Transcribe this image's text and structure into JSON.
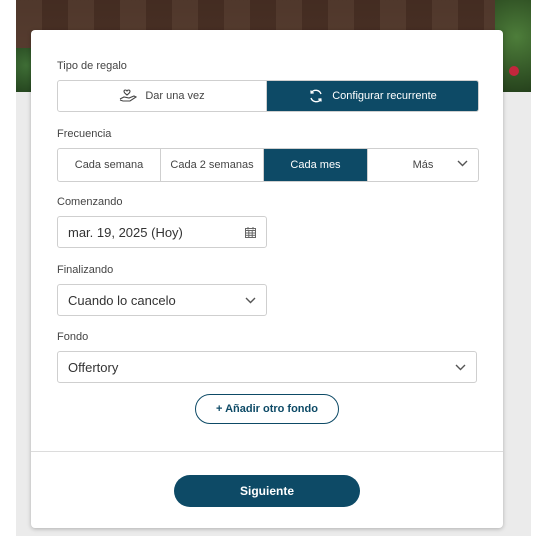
{
  "gift_type": {
    "label": "Tipo de regalo",
    "options": [
      {
        "label": "Dar una vez",
        "icon": "hand-heart-icon",
        "active": false
      },
      {
        "label": "Configurar recurrente",
        "icon": "refresh-icon",
        "active": true
      }
    ]
  },
  "frequency": {
    "label": "Frecuencia",
    "options": [
      {
        "label": "Cada semana",
        "active": false
      },
      {
        "label": "Cada 2 semanas",
        "active": false
      },
      {
        "label": "Cada mes",
        "active": true
      },
      {
        "label": "Más",
        "active": false
      }
    ]
  },
  "start": {
    "label": "Comenzando",
    "value": "mar. 19, 2025 (Hoy)",
    "icon": "calendar-icon"
  },
  "end": {
    "label": "Finalizando",
    "value": "Cuando lo cancelo",
    "icon": "chevron-down-icon"
  },
  "fund": {
    "label": "Fondo",
    "value": "Offertory",
    "icon": "chevron-down-icon"
  },
  "add_fund_label": "+ Añadir otro fondo",
  "next_label": "Siguiente",
  "colors": {
    "accent": "#0d4a66",
    "border": "#cfcfcf",
    "page_background": "#ebebeb"
  }
}
